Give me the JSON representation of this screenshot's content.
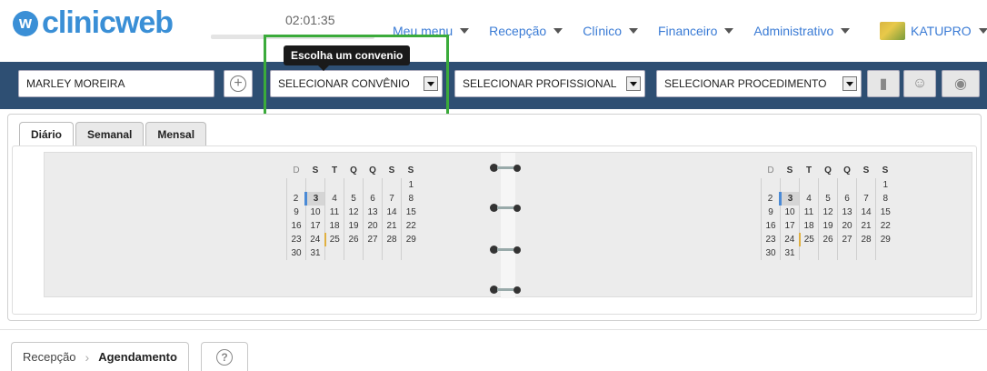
{
  "header": {
    "logo_text": "clinicweb",
    "clock": "02:01:35",
    "nav": [
      {
        "label": "Meu menu"
      },
      {
        "label": "Recepção"
      },
      {
        "label": "Clínico"
      },
      {
        "label": "Financeiro"
      },
      {
        "label": "Administrativo"
      }
    ],
    "user": "KATUPRO"
  },
  "tooltip": "Escolha um convenio",
  "toolbar": {
    "patient": "MARLEY MOREIRA",
    "convenio": "SELECIONAR CONVÊNIO",
    "profissional": "SELECIONAR PROFISSIONAL",
    "procedimento": "SELECIONAR PROCEDIMENTO"
  },
  "tabs": [
    {
      "label": "Diário"
    },
    {
      "label": "Semanal"
    },
    {
      "label": "Mensal"
    }
  ],
  "calendar": {
    "weekdays": [
      "D",
      "S",
      "T",
      "Q",
      "Q",
      "S",
      "S"
    ],
    "weeks": [
      [
        "",
        "",
        "",
        "",
        "",
        "",
        "1"
      ],
      [
        "2",
        "3",
        "4",
        "5",
        "6",
        "7",
        "8"
      ],
      [
        "9",
        "10",
        "11",
        "12",
        "13",
        "14",
        "15"
      ],
      [
        "16",
        "17",
        "18",
        "19",
        "20",
        "21",
        "22"
      ],
      [
        "23",
        "24",
        "25",
        "26",
        "27",
        "28",
        "29"
      ],
      [
        "30",
        "31",
        "",
        "",
        "",
        "",
        ""
      ]
    ]
  },
  "breadcrumb": {
    "parent": "Recepção",
    "current": "Agendamento"
  },
  "colors": {
    "toolbar": "#2e4f73",
    "brand": "#3a8fd6",
    "highlight": "#3bab3b"
  }
}
